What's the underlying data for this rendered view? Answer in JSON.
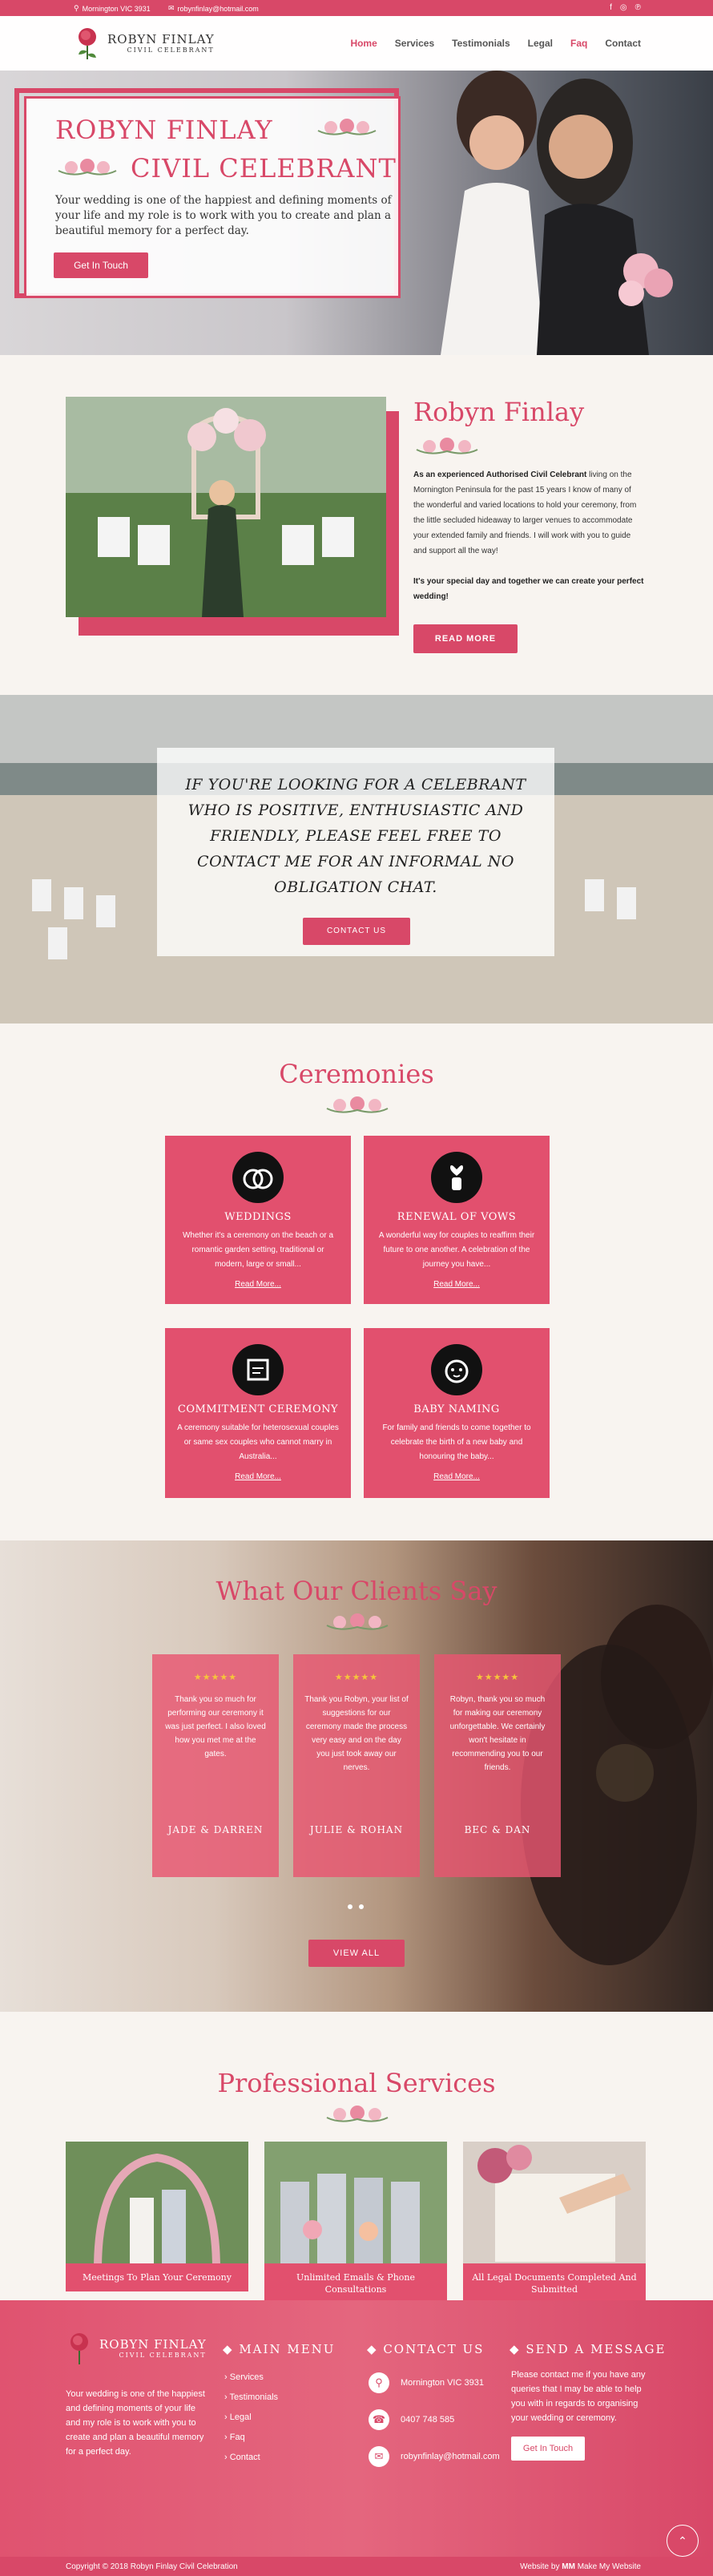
{
  "topbar": {
    "location": "Mornington VIC 3931",
    "email": "robynfinlay@hotmail.com",
    "social_icons": [
      "facebook-icon",
      "instagram-icon",
      "pinterest-icon"
    ]
  },
  "brand": {
    "name": "ROBYN FINLAY",
    "tagline": "CIVIL CELEBRANT"
  },
  "nav": {
    "items": [
      "Home",
      "Services",
      "Testimonials",
      "Legal",
      "Faq",
      "Contact"
    ],
    "active": "Home"
  },
  "hero": {
    "title_line1": "ROBYN FINLAY",
    "title_line2": "CIVIL CELEBRANT",
    "text": "Your wedding is one of the happiest and defining moments of your life and my role is to work with you to create and plan a beautiful memory for a perfect day.",
    "button": "Get In Touch"
  },
  "about": {
    "name": "Robyn Finlay",
    "intro_bold": "As an experienced Authorised Civil Celebrant",
    "intro_rest": " living on the Mornington Peninsula for the past 15 years I know of many of the wonderful and varied locations to hold your ceremony, from the little secluded hideaway to larger venues to accommodate your extended family and friends. I will work with you to guide and support all the way!",
    "closing": "It's your special day and together we can create your perfect wedding!",
    "button": "READ MORE"
  },
  "banner": {
    "text": "IF YOU'RE LOOKING FOR A CELEBRANT WHO IS POSITIVE, ENTHUSIASTIC AND FRIENDLY, PLEASE FEEL FREE TO CONTACT ME FOR AN INFORMAL NO OBLIGATION CHAT.",
    "button": "CONTACT US"
  },
  "ceremonies": {
    "title": "Ceremonies",
    "cards": [
      {
        "icon": "rings-icon",
        "title": "WEDDINGS",
        "text": "Whether it's a ceremony on the beach or a romantic garden setting, traditional or modern, large or small...",
        "link": "Read More..."
      },
      {
        "icon": "hand-heart-icon",
        "title": "RENEWAL OF VOWS",
        "text": "A wonderful way for couples to reaffirm their future to one another. A celebration of the journey you have...",
        "link": "Read More..."
      },
      {
        "icon": "certificate-icon",
        "title": "COMMITMENT CEREMONY",
        "text": "A ceremony suitable for heterosexual couples or same sex couples who cannot marry in Australia...",
        "link": "Read More..."
      },
      {
        "icon": "baby-icon",
        "title": "BABY NAMING",
        "text": "For family and friends to come together to celebrate the birth of a new baby and honouring the baby...",
        "link": "Read More..."
      }
    ]
  },
  "testimonials": {
    "title": "What Our Clients Say",
    "stars": "★★★★★",
    "items": [
      {
        "text": "Thank you so much for performing our ceremony it was just perfect. I also loved how you met me at the gates.",
        "name": "JADE & DARREN"
      },
      {
        "text": "Thank you Robyn, your list of suggestions for our ceremony made the process very easy and on the day you just took away our nerves.",
        "name": "JULIE & ROHAN"
      },
      {
        "text": "Robyn, thank you so much for making our ceremony unforgettable. We certainly won't hesitate in recommending you to our friends.",
        "name": "BEC & DAN"
      }
    ],
    "button": "VIEW ALL"
  },
  "services": {
    "title": "Professional Services",
    "items": [
      {
        "label": "Meetings To Plan Your Ceremony"
      },
      {
        "label": "Unlimited Emails & Phone Consultations"
      },
      {
        "label": "All Legal Documents Completed And Submitted"
      }
    ]
  },
  "footer": {
    "about_text": "Your wedding is one of the happiest and defining moments of your life and my role is to work with you to create and plan a beautiful memory for a perfect day.",
    "menu_title": "MAIN MENU",
    "menu_items": [
      "Services",
      "Testimonials",
      "Legal",
      "Faq",
      "Contact"
    ],
    "contact_title": "CONTACT US",
    "contact_location": "Mornington VIC 3931",
    "contact_phone": "0407 748 585",
    "contact_email": "robynfinlay@hotmail.com",
    "message_title": "SEND A MESSAGE",
    "message_text": "Please contact me if you have any queries that I may be able to help you with in regards to organising your wedding or ceremony.",
    "message_button": "Get In Touch",
    "copyright": "Copyright © 2018 Robyn Finlay Civil Celebration",
    "credit_prefix": "Website by",
    "credit_name": "Make My Website"
  },
  "colors": {
    "accent": "#d84868",
    "card": "#e2506e"
  }
}
